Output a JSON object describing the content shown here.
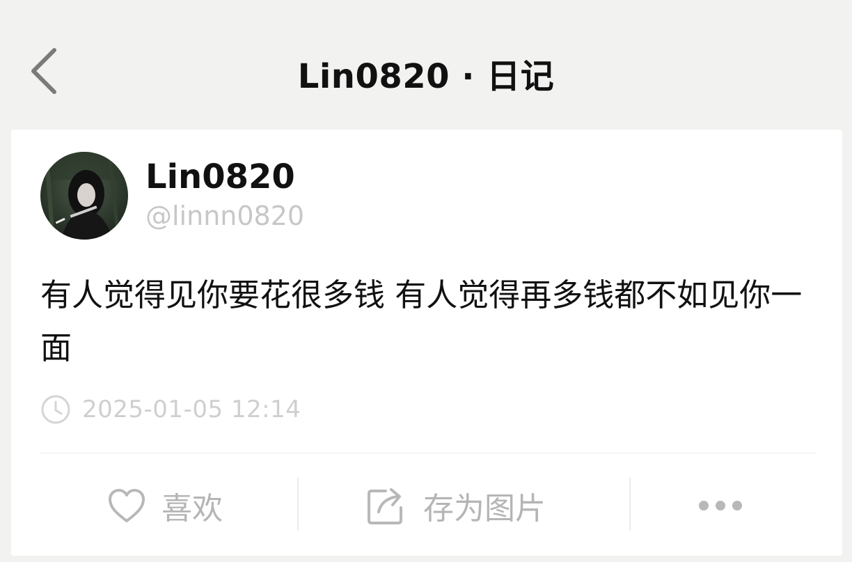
{
  "header": {
    "title": "Lin0820 · 日记",
    "back_icon": "chevron-left-icon"
  },
  "post": {
    "author_name": "Lin0820",
    "author_handle": "@linnn0820",
    "text": "有人觉得见你要花很多钱 有人觉得再多钱都不如见你一面",
    "timestamp": "2025-01-05 12:14",
    "timestamp_icon": "clock-icon"
  },
  "actions": {
    "like_label": "喜欢",
    "like_icon": "heart-icon",
    "save_label": "存为图片",
    "save_icon": "share-export-icon",
    "more_icon": "more-dots-icon"
  },
  "colors": {
    "page_bg": "#f2f2f0",
    "card_bg": "#ffffff",
    "primary_text": "#111111",
    "muted_text": "#c7c7c7",
    "action_grey": "#b5b5b5"
  }
}
